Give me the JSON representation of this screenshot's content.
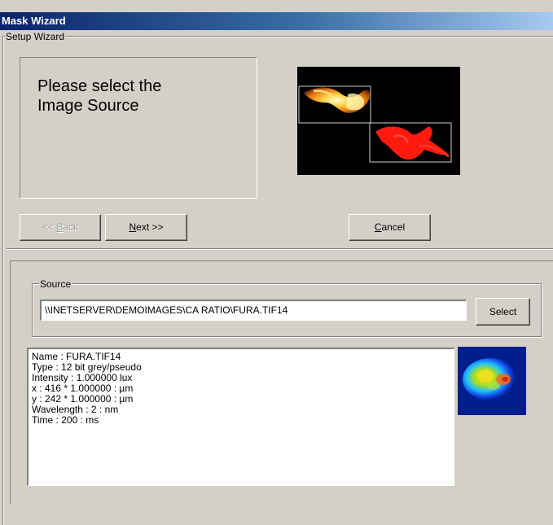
{
  "window": {
    "title": "Mask Wizard"
  },
  "wizard": {
    "group_label": "Setup Wizard",
    "heading_line1": "Please select the",
    "heading_line2": "Image Source",
    "buttons": {
      "back": {
        "prefix": "<< ",
        "key": "B",
        "rest": "ack"
      },
      "next": {
        "key": "N",
        "rest": "ext >>"
      },
      "cancel": {
        "key": "C",
        "rest": "ancel"
      }
    }
  },
  "source": {
    "group_label": "Source",
    "path_value": "\\\\INETSERVER\\DEMOIMAGES\\CA RATIO\\FURA.TIF14",
    "select_label": "Select"
  },
  "image_info": {
    "lines": [
      "Name : FURA.TIF14",
      "Type : 12 bit grey/pseudo",
      "Intensity : 1.000000 lux",
      "x : 416 * 1.000000 : µm",
      "y : 242 * 1.000000 : µm",
      "Wavelength : 2 : nm",
      "Time : 200 : ms"
    ]
  }
}
